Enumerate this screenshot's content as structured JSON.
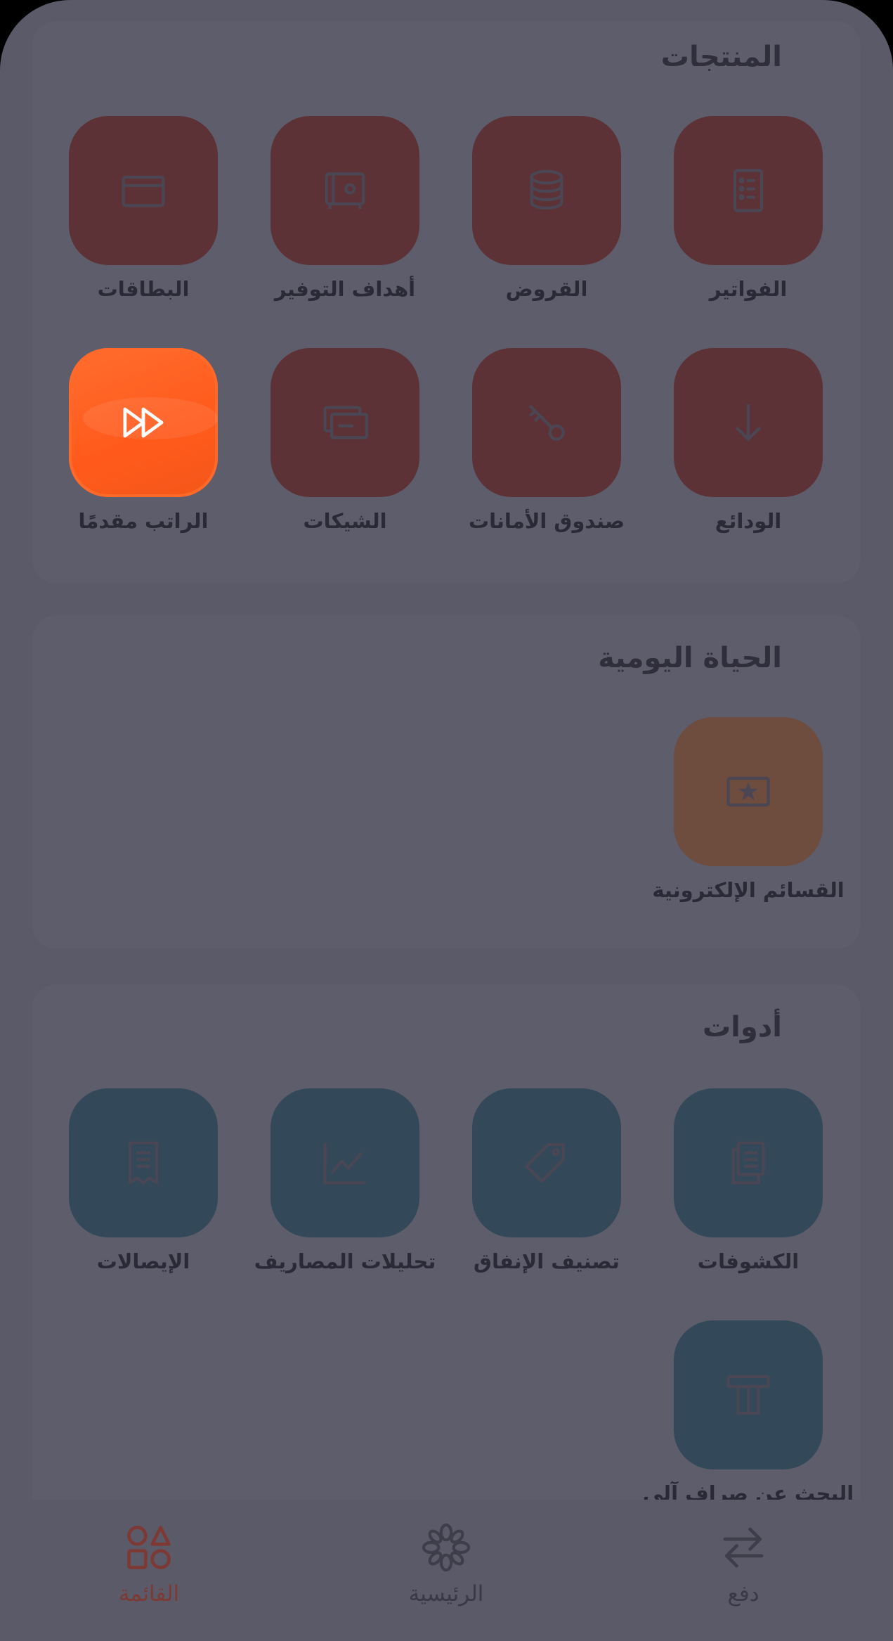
{
  "sections": {
    "products": {
      "title": "المنتجات",
      "items": [
        {
          "label": "الفواتير",
          "icon": "invoice-icon"
        },
        {
          "label": "القروض",
          "icon": "coins-stack-icon"
        },
        {
          "label": "أهداف التوفير",
          "icon": "safe-icon"
        },
        {
          "label": "البطاقات",
          "icon": "card-icon"
        },
        {
          "label": "الودائع",
          "icon": "arrow-down-icon"
        },
        {
          "label": "صندوق الأمانات",
          "icon": "key-icon"
        },
        {
          "label": "الشيكات",
          "icon": "cheques-icon"
        },
        {
          "label": "الراتب مقدمًا",
          "icon": "fast-forward-icon"
        }
      ]
    },
    "daily_life": {
      "title": "الحياة اليومية",
      "items": [
        {
          "label": "القسائم الإلكترونية",
          "icon": "voucher-star-icon"
        }
      ]
    },
    "tools": {
      "title": "أدوات",
      "items": [
        {
          "label": "الكشوفات",
          "icon": "statements-icon"
        },
        {
          "label": "تصنيف الإنفاق",
          "icon": "tag-icon"
        },
        {
          "label": "تحليلات المصاريف",
          "icon": "line-chart-icon"
        },
        {
          "label": "الإيصالات",
          "icon": "receipt-icon"
        },
        {
          "label": "البحث عن صراف آلي",
          "icon": "atm-icon"
        }
      ]
    }
  },
  "tabbar": {
    "tabs": [
      {
        "label": "دفع",
        "icon": "transfer-arrows-icon",
        "active": false
      },
      {
        "label": "الرئيسية",
        "icon": "home-logo-icon",
        "active": false
      },
      {
        "label": "القائمة",
        "icon": "shapes-menu-icon",
        "active": true
      }
    ]
  },
  "colors": {
    "overlay": "#5a5a68",
    "products_tile": "#5d3236",
    "daily_tile": "#6e4c3e",
    "tools_tile": "#33495a",
    "highlight_tile": "#ff5e20",
    "active_tab": "#7d3a35"
  }
}
